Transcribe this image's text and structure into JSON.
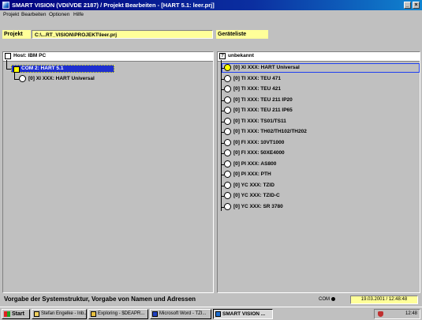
{
  "window": {
    "title": "SMART VISION (VDI/VDE 2187) / Projekt Bearbeiten - [HART 5.1: leer.prj]"
  },
  "menu": {
    "items": [
      {
        "label": "Projekt",
        "accel": "P"
      },
      {
        "label": "Bearbeiten",
        "accel": "B"
      },
      {
        "label": "Optionen",
        "accel": "O"
      },
      {
        "label": "Hilfe",
        "accel": ""
      }
    ]
  },
  "project": {
    "label": "Projekt",
    "path": "C:\\...RT_VISION\\PROJEKT\\leer.prj",
    "device_list_label": "Geräteliste"
  },
  "left_panel": {
    "header": "Host: IBM PC",
    "com_node": "COM 2: HART 5.1",
    "child_node": "[0] XI XXX: HART Universal"
  },
  "right_panel": {
    "header": "unbekannt",
    "header_icon": "?",
    "devices": [
      "[0] XI XXX: HART Universal",
      "[0] TI XXX: TEU 471",
      "[0] TI XXX: TEU 421",
      "[0] TI XXX: TEU 211 IP20",
      "[0] TI XXX: TEU 211 IP65",
      "[0] TI XXX: TS01/TS11",
      "[0] TI XXX: TH02/TH102/TH202",
      "[0] FI XXX: 10VT1000",
      "[0] FI XXX: 50XE4000",
      "[0] PI XXX: AS800",
      "[0] PI XXX: PTH",
      "[0] YC XXX: TZID",
      "[0] YC XXX: TZID-C",
      "[0] YC XXX: SR 3780"
    ]
  },
  "status": {
    "text": "Vorgabe der Systemstruktur, Vorgabe von Namen und Adressen",
    "com_label": "COM",
    "datetime": "19.03.2001 / 12:48:48"
  },
  "taskbar": {
    "start_label": "Start",
    "tasks": [
      {
        "label": "Stefan Engelke - Inb...",
        "icon": "mail-icon"
      },
      {
        "label": "Exploring - $DEAPR...",
        "icon": "folder-icon"
      },
      {
        "label": "Microsoft Word - TZI...",
        "icon": "word-icon"
      },
      {
        "label": "SMART VISION ...",
        "icon": "app-icon",
        "active": true
      }
    ],
    "clock": "12:48"
  },
  "colors": {
    "title_bar": "#000080",
    "field_yellow": "#ffff99",
    "selection_blue": "#1e2fd0",
    "node_yellow": "#ffff00"
  }
}
